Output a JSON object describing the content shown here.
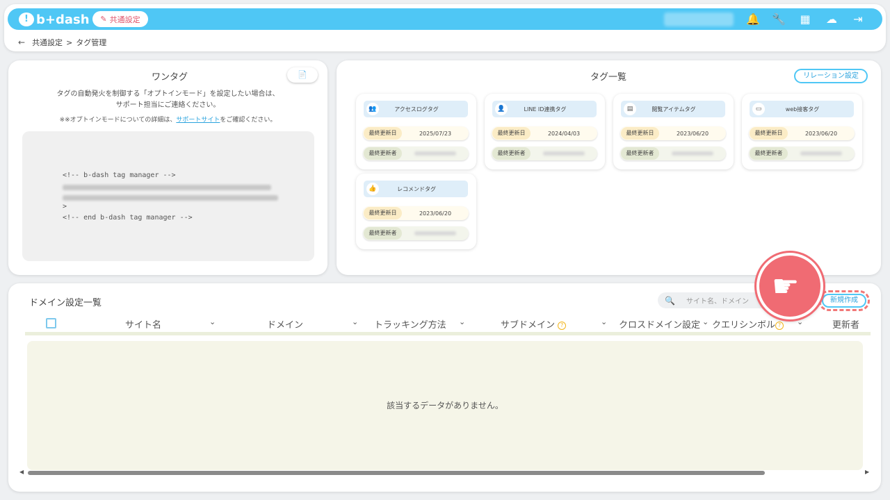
{
  "header": {
    "logo_text": "b+dash",
    "common_settings_label": "共通設定",
    "icons": [
      "bell-icon",
      "wrench-icon",
      "grid-icon",
      "chat-icon",
      "logout-icon"
    ]
  },
  "breadcrumb": {
    "back": "←",
    "parent": "共通設定",
    "separator": ">",
    "current": "タグ管理"
  },
  "onetag": {
    "title": "ワンタグ",
    "copy_icon": "📄",
    "desc_line1": "タグの自動発火を制御する「オプトインモード」を設定したい場合は、",
    "desc_line2": "サポート担当にご連絡ください。",
    "note_prefix": "※※オプトインモードについての詳細は、",
    "note_link": "サポートサイト",
    "note_suffix": "をご確認ください。",
    "code_start": "<!-- b-dash tag manager -->",
    "code_close": ">",
    "code_end": "<!-- end b-dash tag manager -->"
  },
  "taglist": {
    "title": "タグ一覧",
    "relation_button": "リレーション設定",
    "date_label": "最終更新日",
    "user_label": "最終更新者",
    "cards": [
      {
        "name": "アクセスログタグ",
        "icon": "👥",
        "date": "2025/07/23"
      },
      {
        "name": "LINE ID連携タグ",
        "icon": "👤",
        "date": "2024/04/03"
      },
      {
        "name": "閲覧アイテムタグ",
        "icon": "▤",
        "date": "2023/06/20"
      },
      {
        "name": "web接客タグ",
        "icon": "▭",
        "date": "2023/06/20"
      },
      {
        "name": "レコメンドタグ",
        "icon": "👍",
        "date": "2023/06/20"
      }
    ]
  },
  "domain": {
    "title": "ドメイン設定一覧",
    "search_icon": "🔍",
    "search_placeholder": "サイト名、ドメイン",
    "new_button": "新規作成",
    "help": "?",
    "chev": "⌄",
    "columns": {
      "site": "サイト名",
      "domain": "ドメイン",
      "tracking": "トラッキング方法",
      "subdomain": "サブドメイン",
      "crossdomain": "クロスドメイン設定",
      "query": "クエリシンボル",
      "updater": "更新者"
    },
    "empty_message": "該当するデータがありません。",
    "scroll_left": "◀",
    "scroll_right": "▶"
  },
  "colors": {
    "accent": "#4fc7f5",
    "highlight": "#f06b73",
    "help": "#f2b51b"
  }
}
